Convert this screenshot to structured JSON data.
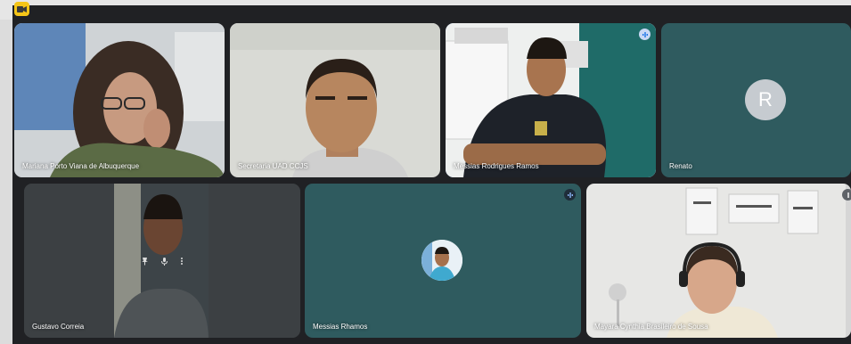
{
  "app": {
    "icon": "meet-app-icon"
  },
  "participants": [
    {
      "name": "Mariana Porto Viana de Albuquerque",
      "kind": "video"
    },
    {
      "name": "Secretaria UAD CCJS",
      "kind": "video"
    },
    {
      "name": "Messias Rodrigues Ramos",
      "kind": "video",
      "speaking": true
    },
    {
      "name": "Renato",
      "kind": "avatar",
      "initial": "R"
    },
    {
      "name": "Gustavo Correia",
      "kind": "video",
      "hover_actions": [
        "pin-icon",
        "mute-icon",
        "more-options-icon"
      ]
    },
    {
      "name": "Messias Rhamos",
      "kind": "avatar-photo"
    },
    {
      "name": "Mayara Cynthia Brasileiro de Sousa",
      "kind": "video"
    }
  ],
  "colors": {
    "tile_bg": "#3c4043",
    "avatar_tile_bg": "#2f5b5f",
    "speaking_border": "#8ab4f8",
    "stage_bg": "#202124"
  }
}
